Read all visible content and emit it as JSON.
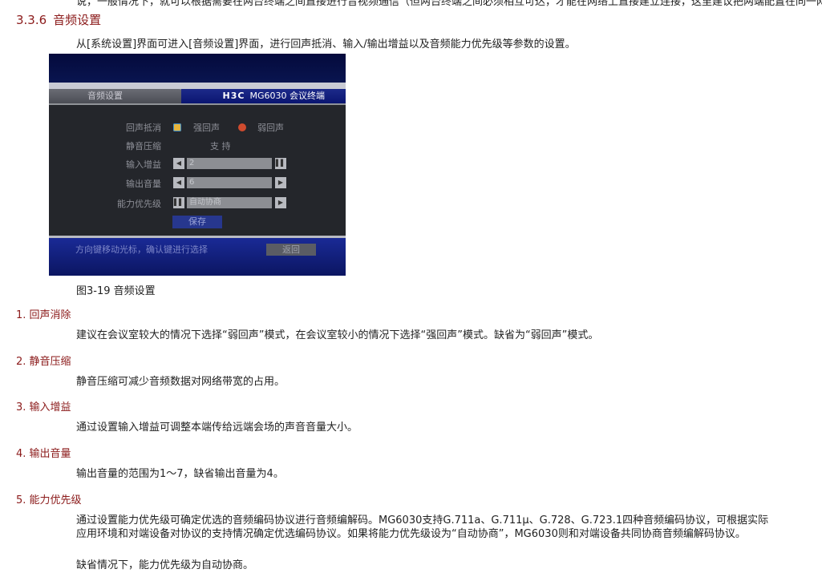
{
  "top_cut_text": "说，一般情况下，就可以根据需要在两台终端之间直接进行音视频通信（但两台终端之间必须相互可达，才能在网络上直接建立连接，这里建议把两端配置在同一网段）。",
  "section": {
    "number": "3.3.6",
    "title": "音频设置"
  },
  "intro": "从[系统设置]界面可进入[音频设置]界面，进行回声抵消、输入/输出增益以及音频能力优先级等参数的设置。",
  "screen": {
    "tab_title": "音频设置",
    "brand_logo": "H3C",
    "brand_model": "MG6030 会议终端",
    "rows": {
      "echo": {
        "label": "回声抵消",
        "opt1": "强回声",
        "opt2": "弱回声"
      },
      "silence": {
        "label": "静音压缩",
        "value": "支 持"
      },
      "input_gain": {
        "label": "输入增益",
        "value": "2"
      },
      "output_volume": {
        "label": "输出音量",
        "value": "6"
      },
      "priority": {
        "label": "能力优先级",
        "value": "自动协商"
      }
    },
    "save_label": "保存",
    "footer_hint": "方向键移动光标，确认键进行选择",
    "back_label": "返回",
    "icons": {
      "left": "◀",
      "right": "▶",
      "pause": "▌▌"
    }
  },
  "caption": "图3-19 音频设置",
  "items": [
    {
      "head": "1. 回声消除",
      "body": "建议在会议室较大的情况下选择“弱回声”模式，在会议室较小的情况下选择“强回声”模式。缺省为“弱回声”模式。"
    },
    {
      "head": "2. 静音压缩",
      "body": "静音压缩可减少音频数据对网络带宽的占用。"
    },
    {
      "head": "3. 输入增益",
      "body": "通过设置输入增益可调整本端传给远端会场的声音音量大小。"
    },
    {
      "head": "4. 输出音量",
      "body": "输出音量的范围为1～7，缺省输出音量为4。"
    },
    {
      "head": "5. 能力优先级",
      "body": "通过设置能力优先级可确定优选的音频编码协议进行音频编解码。MG6030支持G.711a、G.711μ、G.728、G.723.1四种音频编码协议，可根据实际应用环境和对端设备对协议的支持情况确定优选编码协议。如果将能力优先级设为“自动协商”，MG6030则和对端设备共同协商音频编解码协议。",
      "body2": "缺省情况下，能力优先级为自动协商。"
    }
  ]
}
